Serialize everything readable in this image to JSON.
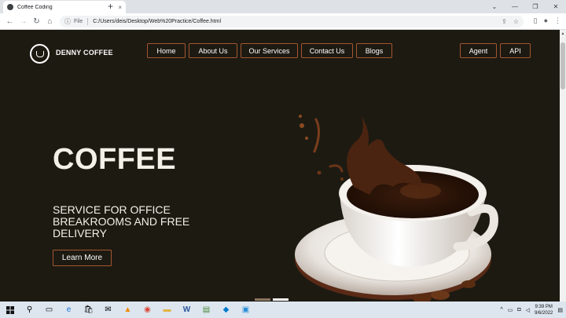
{
  "browser": {
    "tab_title": "Coffee Coding",
    "new_tab": "+",
    "close_tab": "×",
    "url_scheme": "File",
    "url": "C:/Users/deis/Desktop/Web%20Practice/Coffee.html",
    "win_min": "—",
    "win_max": "❐",
    "win_close": "✕",
    "collapse": "⌄"
  },
  "site": {
    "brand": "DENNY COFFEE",
    "nav": [
      "Home",
      "About Us",
      "Our Services",
      "Contact Us",
      "Blogs"
    ],
    "nav_right": [
      "Agent",
      "API"
    ],
    "hero_title": "COFFEE",
    "hero_subtitle": "SERVICE FOR OFFICE BREAKROOMS AND FREE DELIVERY",
    "cta": "Learn More",
    "slider": {
      "count": 2,
      "active_index": 1
    }
  },
  "taskbar": {
    "time": "9:39 PM",
    "date": "9/6/2022"
  },
  "colors": {
    "page_bg": "#1d1a12",
    "accent_border": "#a3562f",
    "hero_text": "#f3f0e8"
  }
}
